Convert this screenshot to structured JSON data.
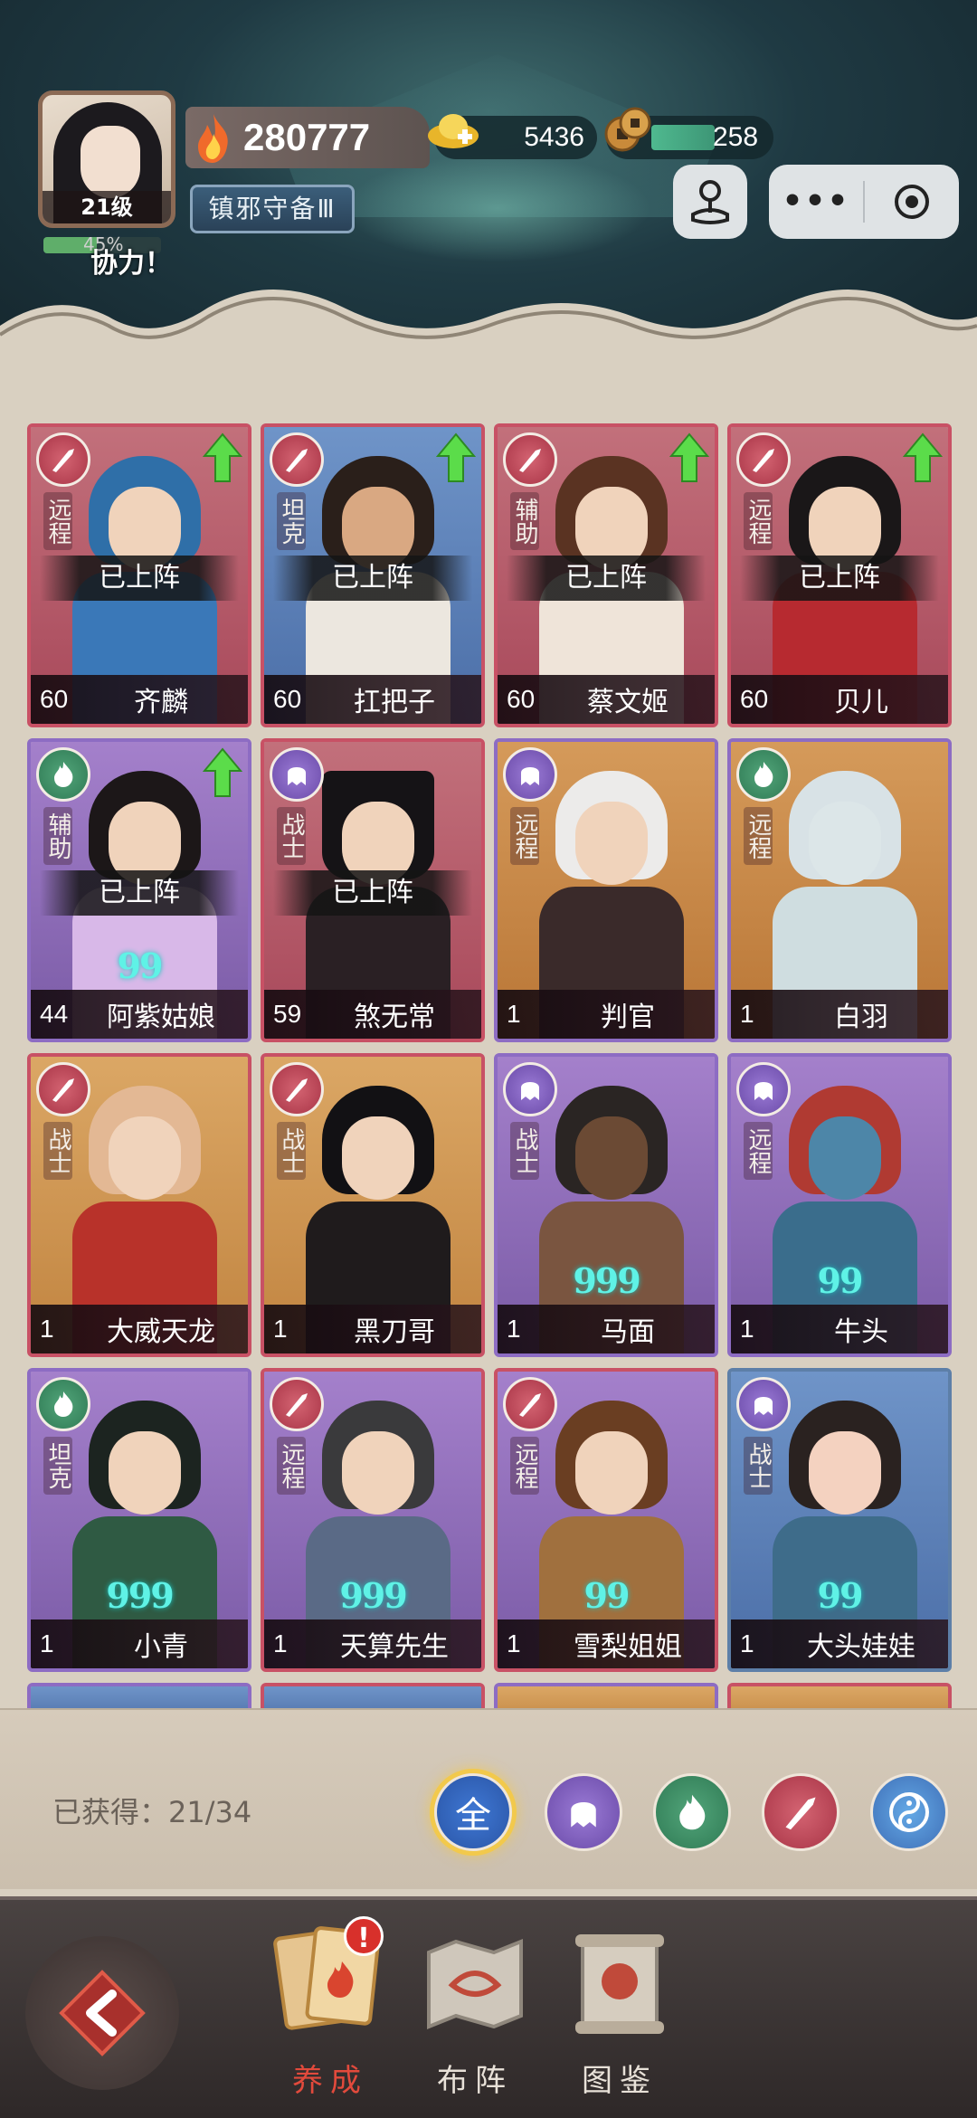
{
  "header": {
    "level": "21级",
    "power": "280777",
    "ingot": "5436",
    "coin": "258",
    "title_badge": "镇邪守备Ⅲ",
    "xp_percent": "45%",
    "motto": "协力！"
  },
  "cards": [
    {
      "role": "远程",
      "deployed": "已上阵",
      "level": "60",
      "name": "齐麟",
      "stars": "",
      "upgrade": true
    },
    {
      "role": "坦克",
      "deployed": "已上阵",
      "level": "60",
      "name": "扛把子",
      "stars": "",
      "upgrade": true
    },
    {
      "role": "辅助",
      "deployed": "已上阵",
      "level": "60",
      "name": "蔡文姬",
      "stars": "",
      "upgrade": true
    },
    {
      "role": "远程",
      "deployed": "已上阵",
      "level": "60",
      "name": "贝儿",
      "stars": "",
      "upgrade": true
    },
    {
      "role": "辅助",
      "deployed": "已上阵",
      "level": "44",
      "name": "阿紫姑娘",
      "stars": "99",
      "upgrade": true
    },
    {
      "role": "战士",
      "deployed": "已上阵",
      "level": "59",
      "name": "煞无常",
      "stars": "",
      "upgrade": false
    },
    {
      "role": "远程",
      "deployed": "",
      "level": "1",
      "name": "判官",
      "stars": "",
      "upgrade": false
    },
    {
      "role": "远程",
      "deployed": "",
      "level": "1",
      "name": "白羽",
      "stars": "",
      "upgrade": false
    },
    {
      "role": "战士",
      "deployed": "",
      "level": "1",
      "name": "大威天龙",
      "stars": "",
      "upgrade": false
    },
    {
      "role": "战士",
      "deployed": "",
      "level": "1",
      "name": "黑刀哥",
      "stars": "",
      "upgrade": false
    },
    {
      "role": "战士",
      "deployed": "",
      "level": "1",
      "name": "马面",
      "stars": "999",
      "upgrade": false
    },
    {
      "role": "远程",
      "deployed": "",
      "level": "1",
      "name": "牛头",
      "stars": "99",
      "upgrade": false
    },
    {
      "role": "坦克",
      "deployed": "",
      "level": "1",
      "name": "小青",
      "stars": "999",
      "upgrade": false
    },
    {
      "role": "远程",
      "deployed": "",
      "level": "1",
      "name": "天算先生",
      "stars": "999",
      "upgrade": false
    },
    {
      "role": "远程",
      "deployed": "",
      "level": "1",
      "name": "雪梨姐姐",
      "stars": "99",
      "upgrade": false
    },
    {
      "role": "战士",
      "deployed": "",
      "level": "1",
      "name": "大头娃娃",
      "stars": "99",
      "upgrade": false
    }
  ],
  "obtained": {
    "label": "已获得：21/34",
    "filter_all": "全"
  },
  "tabs": [
    {
      "label": "养成",
      "active": true,
      "badge": "!"
    },
    {
      "label": "布阵",
      "active": false
    },
    {
      "label": "图鉴",
      "active": false
    }
  ],
  "colors": {
    "accent_red": "#c74a5d",
    "active_tab": "#e24a3c",
    "star_cyan": "#5ff2e6"
  }
}
